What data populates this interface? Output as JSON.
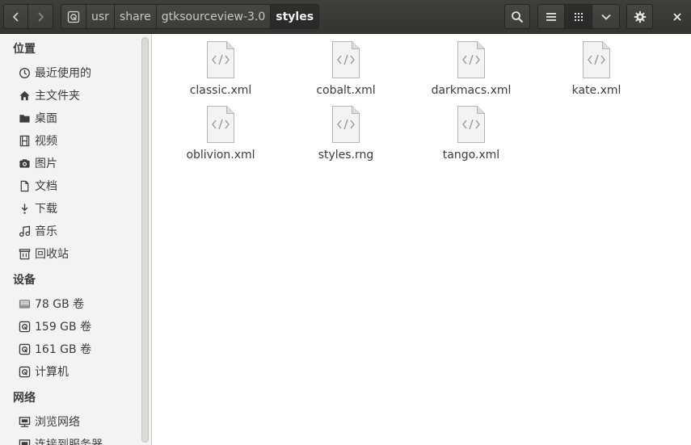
{
  "window": {
    "headerbar": {
      "path": [
        "usr",
        "share",
        "gtksourceview-3.0",
        "styles"
      ],
      "buttons": {
        "back_icon": "chevron-left-icon",
        "forward_icon": "chevron-right-icon",
        "search_icon": "search-icon",
        "list_view_icon": "list-view-icon",
        "grid_view_icon": "grid-view-icon",
        "view_options_icon": "chevron-down-icon",
        "settings_icon": "gear-icon",
        "close_icon": "close-icon"
      }
    },
    "sidebar": {
      "sections": [
        {
          "heading": "位置",
          "items": [
            {
              "label": "最近使用的",
              "icon": "clock-icon"
            },
            {
              "label": "主文件夹",
              "icon": "home-icon"
            },
            {
              "label": "桌面",
              "icon": "folder-icon"
            },
            {
              "label": "视频",
              "icon": "film-icon"
            },
            {
              "label": "图片",
              "icon": "camera-icon"
            },
            {
              "label": "文档",
              "icon": "document-icon"
            },
            {
              "label": "下载",
              "icon": "download-icon"
            },
            {
              "label": "音乐",
              "icon": "music-icon"
            },
            {
              "label": "回收站",
              "icon": "trash-icon"
            }
          ]
        },
        {
          "heading": "设备",
          "items": [
            {
              "label": "78 GB 卷",
              "icon": "drive-icon"
            },
            {
              "label": "159 GB 卷",
              "icon": "disk-icon"
            },
            {
              "label": "161 GB 卷",
              "icon": "disk-icon"
            },
            {
              "label": "计算机",
              "icon": "disk-icon"
            }
          ]
        },
        {
          "heading": "网络",
          "items": [
            {
              "label": "浏览网络",
              "icon": "network-icon"
            },
            {
              "label": "连接到服务器",
              "icon": "network-icon"
            }
          ]
        }
      ]
    },
    "files": [
      {
        "name": "classic.xml",
        "icon": "xml-file-icon"
      },
      {
        "name": "cobalt.xml",
        "icon": "xml-file-icon"
      },
      {
        "name": "darkmacs.xml",
        "icon": "xml-file-icon"
      },
      {
        "name": "kate.xml",
        "icon": "xml-file-icon"
      },
      {
        "name": "oblivion.xml",
        "icon": "xml-file-icon"
      },
      {
        "name": "styles.rng",
        "icon": "xml-file-icon"
      },
      {
        "name": "tango.xml",
        "icon": "xml-file-icon"
      }
    ],
    "colors": {
      "headerbar": "#3c3b37",
      "sidebar": "#f3f3f2",
      "accent_text": "#3c3c3c"
    }
  }
}
